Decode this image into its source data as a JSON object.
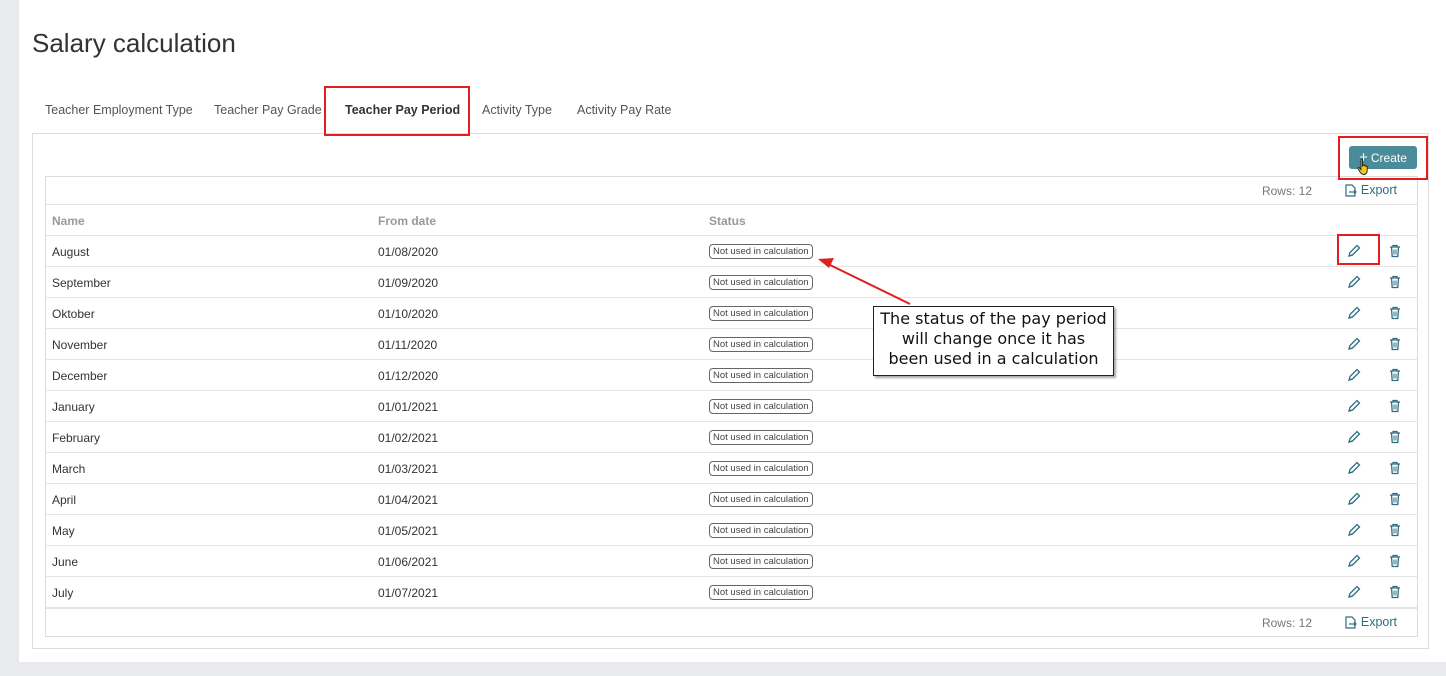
{
  "page": {
    "title": "Salary calculation"
  },
  "tabs": [
    {
      "label": "Teacher Employment Type"
    },
    {
      "label": "Teacher Pay Grade"
    },
    {
      "label": "Teacher Pay Period"
    },
    {
      "label": "Activity Type"
    },
    {
      "label": "Activity Pay Rate"
    }
  ],
  "active_tab": "Teacher Pay Period",
  "toolbar": {
    "create_label": "Create",
    "rows_label": "Rows: 12",
    "export_label": "Export"
  },
  "table": {
    "columns": [
      "Name",
      "From date",
      "Status"
    ],
    "rows": [
      {
        "name": "August",
        "from_date": "01/08/2020",
        "status": "Not used in calculation"
      },
      {
        "name": "September",
        "from_date": "01/09/2020",
        "status": "Not used in calculation"
      },
      {
        "name": "Oktober",
        "from_date": "01/10/2020",
        "status": "Not used in calculation"
      },
      {
        "name": "November",
        "from_date": "01/11/2020",
        "status": "Not used in calculation"
      },
      {
        "name": "December",
        "from_date": "01/12/2020",
        "status": "Not used in calculation"
      },
      {
        "name": "January",
        "from_date": "01/01/2021",
        "status": "Not used in calculation"
      },
      {
        "name": "February",
        "from_date": "01/02/2021",
        "status": "Not used in calculation"
      },
      {
        "name": "March",
        "from_date": "01/03/2021",
        "status": "Not used in calculation"
      },
      {
        "name": "April",
        "from_date": "01/04/2021",
        "status": "Not used in calculation"
      },
      {
        "name": "May",
        "from_date": "01/05/2021",
        "status": "Not used in calculation"
      },
      {
        "name": "June",
        "from_date": "01/06/2021",
        "status": "Not used in calculation"
      },
      {
        "name": "July",
        "from_date": "01/07/2021",
        "status": "Not used in calculation"
      }
    ]
  },
  "callout": {
    "lines": [
      "The status of the pay period",
      "will change once it has",
      "been used in a calculation"
    ]
  },
  "icons": {
    "row_actions": [
      "pencil-icon",
      "trash-icon"
    ],
    "export": "export-icon",
    "create": "plus-icon"
  },
  "colors": {
    "accent": "#4b8c9b",
    "link": "#2f6e80",
    "highlight": "#e02020",
    "background": "#e9eaee"
  }
}
